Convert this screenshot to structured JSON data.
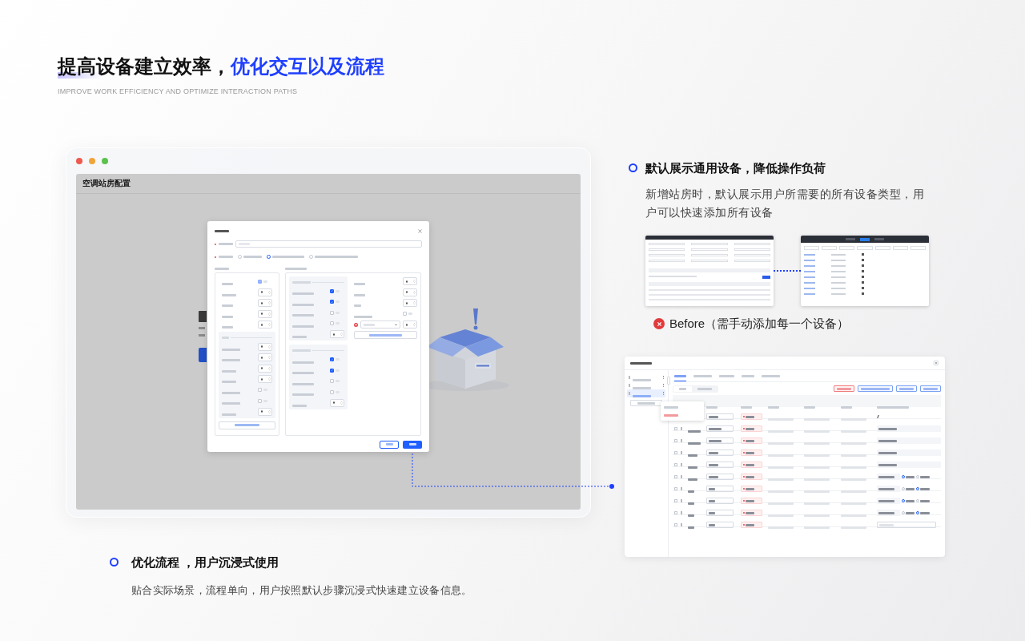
{
  "header": {
    "title": "提高设备建立效率，",
    "highlight": "优化交互以及流程",
    "subtitle": "IMPROVE WORK EFFICIENCY AND OPTIMIZE INTERACTION PATHS"
  },
  "mockup": {
    "page_title": "空调站房配置"
  },
  "feature_default": {
    "heading": "默认展示通用设备，降低操作负荷",
    "text": "新增站房时，默认展示用户所需要的所有设备类型，用户可以快速添加所有设备"
  },
  "before": {
    "label": "Before（需手动添加每一个设备）"
  },
  "feature_flow": {
    "heading": "优化流程 ，用户沉浸式使用",
    "text": "贴合实际场景，流程单向，用户按照默认步骤沉浸式快速建立设备信息。"
  }
}
